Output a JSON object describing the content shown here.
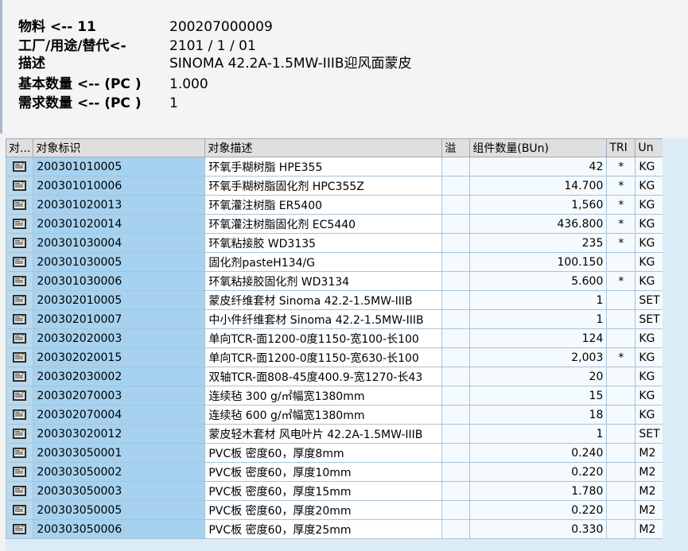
{
  "header": {
    "rows": [
      {
        "label": "物料  <-- 11",
        "value": "200207000009"
      },
      {
        "label": "工厂/用途/替代<-",
        "value": "2101 / 1 / 01"
      },
      {
        "label": "描述",
        "value": "SINOMA 42.2A-1.5MW-IIIB迎风面蒙皮"
      },
      {
        "label": "基本数量  <-- (PC )",
        "value": "1.000"
      },
      {
        "label": "需求数量  <-- (PC )",
        "value": "1"
      }
    ]
  },
  "grid": {
    "columns": [
      "对...",
      "对象标识",
      "对象描述",
      "溢",
      "组件数量(BUn)",
      "TRI",
      "Un"
    ],
    "icon": "document-icon",
    "rows": [
      {
        "id": "200301010005",
        "desc": "环氧手糊树脂 HPE355",
        "qty": "42",
        "tri": "*",
        "un": "KG"
      },
      {
        "id": "200301010006",
        "desc": "环氧手糊树脂固化剂 HPC355Z",
        "qty": "14.700",
        "tri": "*",
        "un": "KG"
      },
      {
        "id": "200301020013",
        "desc": "环氧灌注树脂 ER5400",
        "qty": "1,560",
        "tri": "*",
        "un": "KG"
      },
      {
        "id": "200301020014",
        "desc": "环氧灌注树脂固化剂 EC5440",
        "qty": "436.800",
        "tri": "*",
        "un": "KG"
      },
      {
        "id": "200301030004",
        "desc": "环氧粘接胶 WD3135",
        "qty": "235",
        "tri": "*",
        "un": "KG"
      },
      {
        "id": "200301030005",
        "desc": "固化剂pasteH134/G",
        "qty": "100.150",
        "tri": "",
        "un": "KG"
      },
      {
        "id": "200301030006",
        "desc": "环氧粘接胶固化剂 WD3134",
        "qty": "5.600",
        "tri": "*",
        "un": "KG"
      },
      {
        "id": "200302010005",
        "desc": "蒙皮纤维套材 Sinoma 42.2-1.5MW-IIIB",
        "qty": "1",
        "tri": "",
        "un": "SET"
      },
      {
        "id": "200302010007",
        "desc": "中小件纤维套材 Sinoma 42.2-1.5MW-IIIB",
        "qty": "1",
        "tri": "",
        "un": "SET"
      },
      {
        "id": "200302020003",
        "desc": "单向TCR-面1200-0度1150-宽100-长100",
        "qty": "124",
        "tri": "",
        "un": "KG"
      },
      {
        "id": "200302020015",
        "desc": "单向TCR-面1200-0度1150-宽630-长100",
        "qty": "2,003",
        "tri": "*",
        "un": "KG"
      },
      {
        "id": "200302030002",
        "desc": "双轴TCR-面808-45度400.9-宽1270-长43",
        "qty": "20",
        "tri": "",
        "un": "KG"
      },
      {
        "id": "200302070003",
        "desc": "连续毡 300 g/㎡幅宽1380mm",
        "qty": "15",
        "tri": "",
        "un": "KG"
      },
      {
        "id": "200302070004",
        "desc": "连续毡 600 g/㎡幅宽1380mm",
        "qty": "18",
        "tri": "",
        "un": "KG"
      },
      {
        "id": "200303020012",
        "desc": "蒙皮轻木套材 风电叶片 42.2A-1.5MW-IIIB",
        "qty": "1",
        "tri": "",
        "un": "SET"
      },
      {
        "id": "200303050001",
        "desc": "PVC板 密度60，厚度8mm",
        "qty": "0.240",
        "tri": "",
        "un": "M2"
      },
      {
        "id": "200303050002",
        "desc": "PVC板 密度60，厚度10mm",
        "qty": "0.220",
        "tri": "",
        "un": "M2"
      },
      {
        "id": "200303050003",
        "desc": "PVC板 密度60，厚度15mm",
        "qty": "1.780",
        "tri": "",
        "un": "M2"
      },
      {
        "id": "200303050005",
        "desc": "PVC板 密度60，厚度20mm",
        "qty": "0.220",
        "tri": "",
        "un": "M2"
      },
      {
        "id": "200303050006",
        "desc": "PVC板 密度60，厚度25mm",
        "qty": "0.330",
        "tri": "",
        "un": "M2"
      }
    ]
  }
}
